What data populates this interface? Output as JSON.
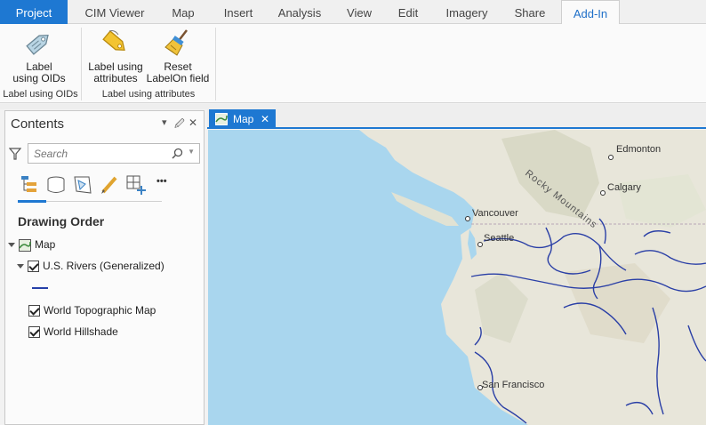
{
  "ribbon": {
    "tabs": [
      {
        "label": "Project"
      },
      {
        "label": "CIM Viewer"
      },
      {
        "label": "Map"
      },
      {
        "label": "Insert"
      },
      {
        "label": "Analysis"
      },
      {
        "label": "View"
      },
      {
        "label": "Edit"
      },
      {
        "label": "Imagery"
      },
      {
        "label": "Share"
      },
      {
        "label": "Add-In"
      }
    ],
    "active_tab": "Add-In",
    "buttons": {
      "label_oids": {
        "line1": "Label",
        "line2": "using OIDs",
        "icon": "tag-icon"
      },
      "label_attributes": {
        "line1": "Label using",
        "line2": "attributes",
        "icon": "label-tag-icon"
      },
      "reset_labelon": {
        "line1": "Reset",
        "line2": "LabelOn field",
        "icon": "broom-icon"
      }
    },
    "groups": {
      "oids": "Label using OIDs",
      "attributes": "Label using attributes"
    }
  },
  "contents": {
    "title": "Contents",
    "search_placeholder": "Search",
    "more_label": "•••",
    "drawing_order": "Drawing Order",
    "tree": {
      "map": "Map",
      "rivers": "U.S. Rivers (Generalized)",
      "topo": "World Topographic Map",
      "hillshade": "World Hillshade"
    }
  },
  "map": {
    "tab_label": "Map",
    "close_glyph": "✕",
    "cities": {
      "edmonton": "Edmonton",
      "calgary": "Calgary",
      "vancouver": "Vancouver",
      "seattle": "Seattle",
      "san_francisco": "San Francisco"
    },
    "rocky": "Rocky Mountains",
    "colors": {
      "ocean": "#a9d6ee",
      "land": "#e8e6da",
      "river": "#2a3fa6"
    }
  },
  "colors": {
    "accent": "#1e78d2"
  }
}
